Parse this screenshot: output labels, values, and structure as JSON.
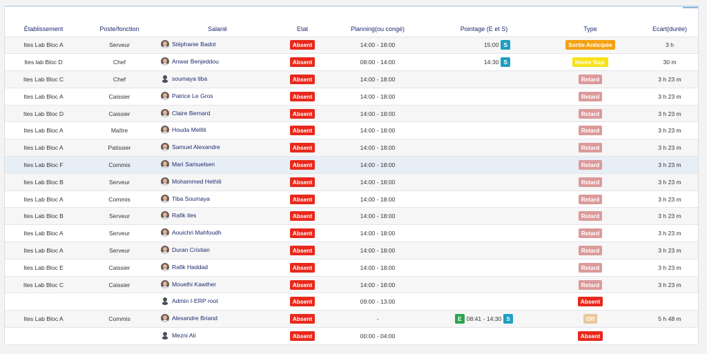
{
  "columns": [
    "Établissement",
    "Poste/fonction",
    "Salarié",
    "Etat",
    "Planning(ou congé)",
    "Pointage (E et S)",
    "Type",
    "Ecart(durée)"
  ],
  "colors": {
    "absent": "#e8291c",
    "retard": "#dc9a9a",
    "sortie": "#f5a113",
    "heure_sup": "#f7e21b",
    "off": "#e8c99a",
    "s_tag": "#1e9fc2",
    "e_tag": "#2ea44f"
  },
  "rows": [
    {
      "etab": "Ites Lab Bloc A",
      "poste": "Serveur",
      "salarie": "Stéphanie Badot",
      "avatar": "photo",
      "etat": "Absent",
      "planning": "14:00 - 18:00",
      "pointage": "15:00",
      "pointage_tag": "S",
      "type": "Sortie Anticipée",
      "type_style": "orange",
      "ecart": "3 h"
    },
    {
      "etab": "Ites lab Bloc D",
      "poste": "Chef",
      "salarie": "Anwar Benjeddou",
      "avatar": "photo",
      "etat": "Absent",
      "planning": "08:00 - 14:00",
      "pointage": "14:30",
      "pointage_tag": "S",
      "type": "Heure Sup.",
      "type_style": "yellow",
      "ecart": "30 m"
    },
    {
      "etab": "Ites Lab Bloc C",
      "poste": "Chef",
      "salarie": "soumaya tiba",
      "avatar": "generic",
      "etat": "Absent",
      "planning": "14:00 - 18:00",
      "pointage": "",
      "pointage_tag": "",
      "type": "Retard",
      "type_style": "pink",
      "ecart": "3 h 23 m"
    },
    {
      "etab": "Ites Lab Bloc A",
      "poste": "Caissier",
      "salarie": "Patrice Le Gros",
      "avatar": "photo",
      "etat": "Absent",
      "planning": "14:00 - 18:00",
      "pointage": "",
      "pointage_tag": "",
      "type": "Retard",
      "type_style": "pink",
      "ecart": "3 h 23 m"
    },
    {
      "etab": "Ites Lab Bloc D",
      "poste": "Caissier",
      "salarie": "Claire Bernard",
      "avatar": "photo",
      "etat": "Absent",
      "planning": "14:00 - 18:00",
      "pointage": "",
      "pointage_tag": "",
      "type": "Retard",
      "type_style": "pink",
      "ecart": "3 h 23 m"
    },
    {
      "etab": "Ites Lab Bloc A",
      "poste": "Maître",
      "salarie": "Houda Melliti",
      "avatar": "photo",
      "etat": "Absent",
      "planning": "14:00 - 18:00",
      "pointage": "",
      "pointage_tag": "",
      "type": "Retard",
      "type_style": "pink",
      "ecart": "3 h 23 m"
    },
    {
      "etab": "Ites Lab Bloc A",
      "poste": "Patissier",
      "salarie": "Samuel Alexandre",
      "avatar": "photo",
      "etat": "Absent",
      "planning": "14:00 - 18:00",
      "pointage": "",
      "pointage_tag": "",
      "type": "Retard",
      "type_style": "pink",
      "ecart": "3 h 23 m"
    },
    {
      "etab": "Ites Lab Bloc F",
      "poste": "Commis",
      "salarie": "Mari Samuelsen",
      "avatar": "photo",
      "etat": "Absent",
      "planning": "14:00 - 18:00",
      "pointage": "",
      "pointage_tag": "",
      "type": "Retard",
      "type_style": "pink",
      "ecart": "3 h 23 m",
      "highlight": true
    },
    {
      "etab": "Ites Lab Bloc B",
      "poste": "Serveur",
      "salarie": "Mohammed Hethili",
      "avatar": "photo",
      "etat": "Absent",
      "planning": "14:00 - 18:00",
      "pointage": "",
      "pointage_tag": "",
      "type": "Retard",
      "type_style": "pink",
      "ecart": "3 h 23 m"
    },
    {
      "etab": "Ites Lab Bloc A",
      "poste": "Commis",
      "salarie": "Tiba Soumaya",
      "avatar": "photo",
      "etat": "Absent",
      "planning": "14:00 - 18:00",
      "pointage": "",
      "pointage_tag": "",
      "type": "Retard",
      "type_style": "pink",
      "ecart": "3 h 23 m"
    },
    {
      "etab": "Ites Lab Bloc B",
      "poste": "Serveur",
      "salarie": "Rafik ites",
      "avatar": "photo",
      "etat": "Absent",
      "planning": "14:00 - 18:00",
      "pointage": "",
      "pointage_tag": "",
      "type": "Retard",
      "type_style": "pink",
      "ecart": "3 h 23 m"
    },
    {
      "etab": "Ites Lab Bloc A",
      "poste": "Serveur",
      "salarie": "Aouichri Mahfoudh",
      "avatar": "photo",
      "etat": "Absent",
      "planning": "14:00 - 18:00",
      "pointage": "",
      "pointage_tag": "",
      "type": "Retard",
      "type_style": "pink",
      "ecart": "3 h 23 m"
    },
    {
      "etab": "Ites Lab Bloc A",
      "poste": "Serveur",
      "salarie": "Duran Cristian",
      "avatar": "photo",
      "etat": "Absent",
      "planning": "14:00 - 18:00",
      "pointage": "",
      "pointage_tag": "",
      "type": "Retard",
      "type_style": "pink",
      "ecart": "3 h 23 m"
    },
    {
      "etab": "Ites Lab Bloc E",
      "poste": "Caissier",
      "salarie": "Rafik Haddad",
      "avatar": "photo",
      "etat": "Absent",
      "planning": "14:00 - 18:00",
      "pointage": "",
      "pointage_tag": "",
      "type": "Retard",
      "type_style": "pink",
      "ecart": "3 h 23 m"
    },
    {
      "etab": "Ites Lab Bloc C",
      "poste": "Caissier",
      "salarie": "Mouelhi Kawther",
      "avatar": "photo",
      "etat": "Absent",
      "planning": "14:00 - 18:00",
      "pointage": "",
      "pointage_tag": "",
      "type": "Retard",
      "type_style": "pink",
      "ecart": "3 h 23 m"
    },
    {
      "etab": "",
      "poste": "",
      "salarie": "Admin I-ERP root",
      "avatar": "generic",
      "etat": "Absent",
      "planning": "09:00 - 13:00",
      "pointage": "",
      "pointage_tag": "",
      "type": "Absent",
      "type_style": "red",
      "ecart": ""
    },
    {
      "etab": "Ites Lab Bloc A",
      "poste": "Commis",
      "salarie": "Alexandre Briand",
      "avatar": "photo",
      "etat": "Absent",
      "planning": "-",
      "pointage": "08:41 - 14:30",
      "pointage_tag": "S",
      "pointage_pre_tag": "E",
      "type": "Off",
      "type_style": "tan",
      "ecart": "5 h 48 m"
    },
    {
      "etab": "",
      "poste": "",
      "salarie": "Mezni Ali",
      "avatar": "generic",
      "etat": "Absent",
      "planning": "00:00 - 04:00",
      "pointage": "",
      "pointage_tag": "",
      "type": "Absent",
      "type_style": "red",
      "ecart": ""
    }
  ]
}
